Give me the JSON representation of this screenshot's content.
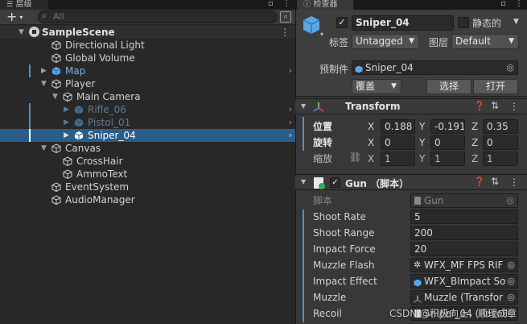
{
  "hierarchy": {
    "tab_label": "层级",
    "search_placeholder": "All",
    "add_label": "+",
    "scene_name": "SampleScene",
    "items": [
      {
        "label": "Directional Light"
      },
      {
        "label": "Global Volume"
      },
      {
        "label": "Map"
      },
      {
        "label": "Player"
      },
      {
        "label": "Main Camera"
      },
      {
        "label": "Rifle_06"
      },
      {
        "label": "Pistol_01"
      },
      {
        "label": "Sniper_04"
      },
      {
        "label": "Canvas"
      },
      {
        "label": "CrossHair"
      },
      {
        "label": "AmmoText"
      },
      {
        "label": "EventSystem"
      },
      {
        "label": "AudioManager"
      }
    ]
  },
  "inspector": {
    "tab_label": "检查器",
    "object_name": "Sniper_04",
    "static_label": "静态的",
    "tag_label": "标签",
    "tag_value": "Untagged",
    "layer_label": "图层",
    "layer_value": "Default",
    "prefab_label": "预制件",
    "prefab_value": "Sniper_04",
    "overrides_label": "覆盖",
    "select_label": "选择",
    "open_label": "打开",
    "transform": {
      "title": "Transform",
      "position_label": "位置",
      "rotation_label": "旋转",
      "scale_label": "缩放",
      "x": "X",
      "y": "Y",
      "z": "Z",
      "position": [
        "0.188",
        "-0.191",
        "0.35"
      ],
      "rotation": [
        "0",
        "0",
        "0"
      ],
      "scale": [
        "1",
        "1",
        "1"
      ]
    },
    "gun": {
      "title": "Gun （脚本）",
      "script_label": "脚本",
      "script_value": "Gun",
      "fields": [
        {
          "label": "Shoot Rate",
          "value": "5"
        },
        {
          "label": "Shoot Range",
          "value": "200"
        },
        {
          "label": "Impact Force",
          "value": "20"
        },
        {
          "label": "Muzzle Flash",
          "value": "WFX_MF FPS RIF"
        },
        {
          "label": "Impact Effect",
          "value": "WFX_BImpact So"
        },
        {
          "label": "Muzzle",
          "value": "Muzzle (Transfor"
        },
        {
          "label": "Recoil",
          "value": "Sniper_04 (Recoil"
        }
      ]
    }
  },
  "watermark": "CSDN @积极向上，顺理成章"
}
